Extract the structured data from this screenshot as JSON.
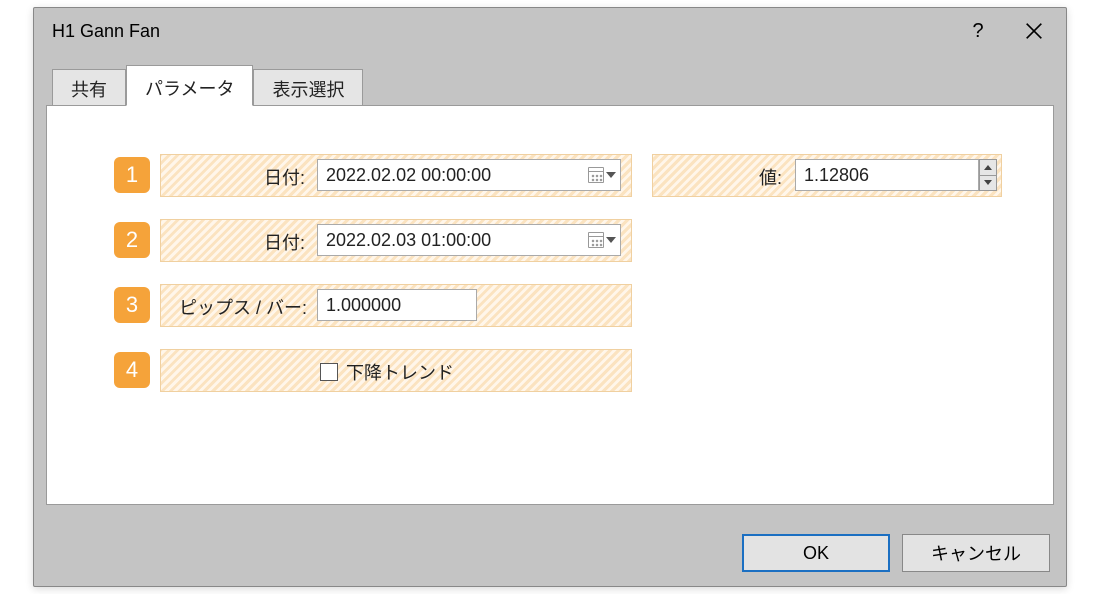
{
  "window": {
    "title": "H1 Gann Fan"
  },
  "tabs": {
    "share": "共有",
    "parameters": "パラメータ",
    "display": "表示選択"
  },
  "badges": {
    "b1": "1",
    "b2": "2",
    "b3": "3",
    "b4": "4"
  },
  "labels": {
    "date": "日付:",
    "value": "値:",
    "pipsPerBar": "ピップス / バー:",
    "downtrend": "下降トレンド"
  },
  "inputs": {
    "date1": "2022.02.02 00:00:00",
    "value1": "1.12806",
    "date2": "2022.02.03 01:00:00",
    "pipsPerBar": "1.000000"
  },
  "buttons": {
    "ok": "OK",
    "cancel": "キャンセル"
  }
}
